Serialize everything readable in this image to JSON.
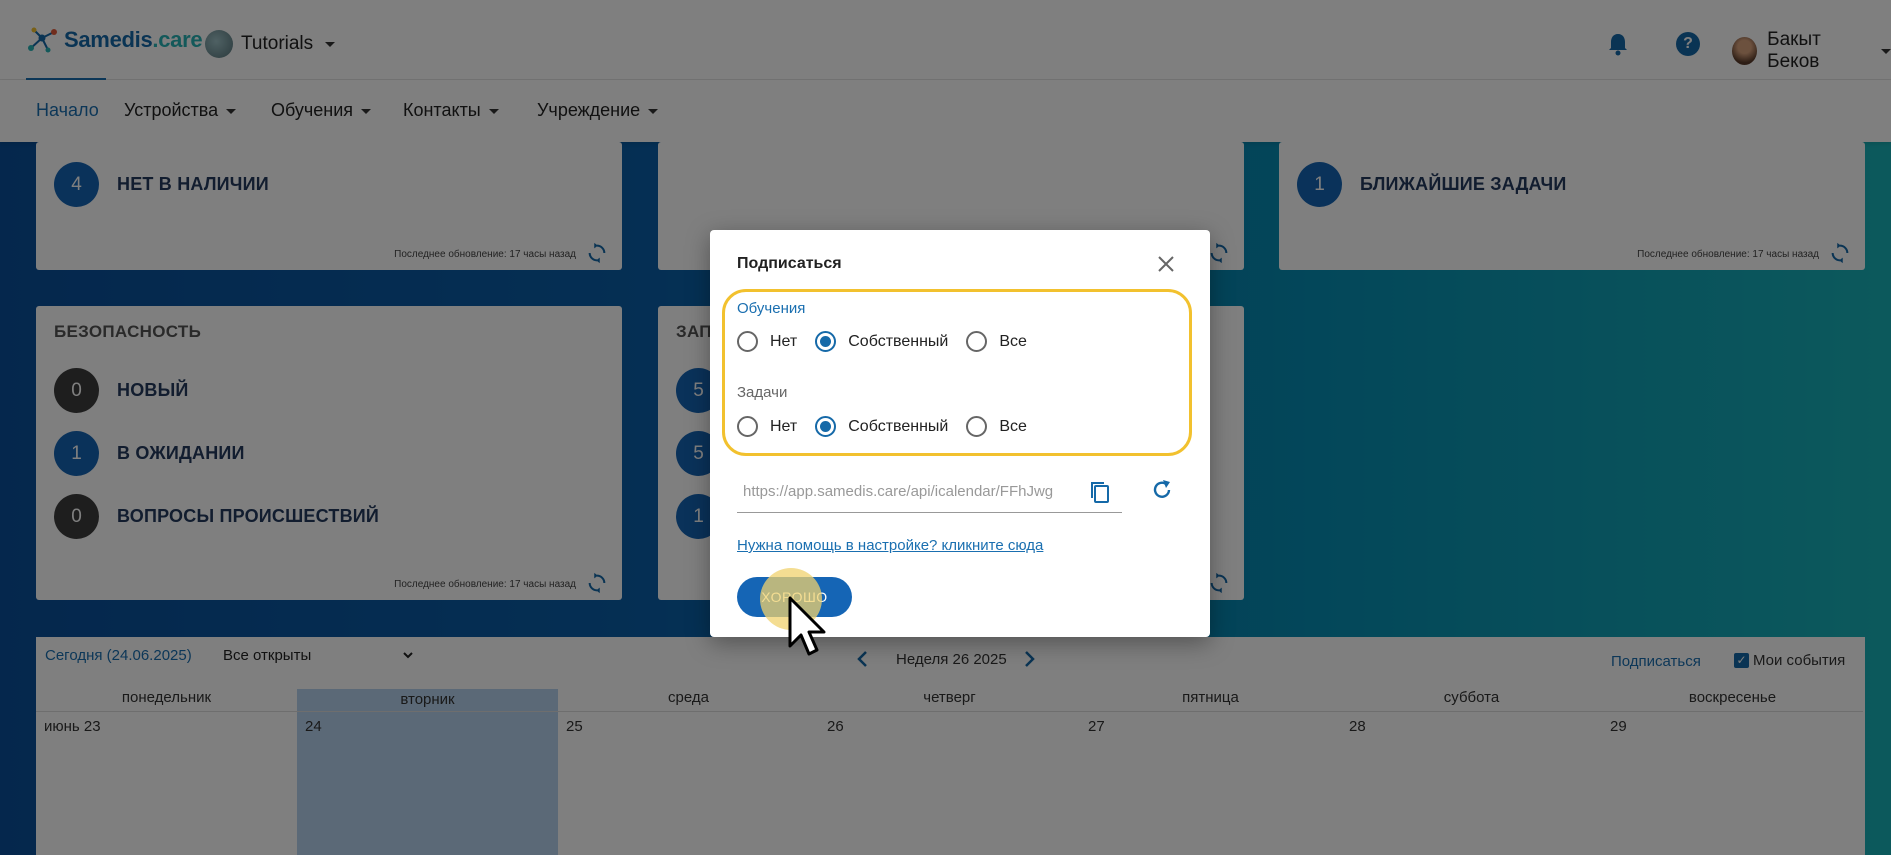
{
  "header": {
    "brand": "Samedis",
    "brand_suffix": ".care",
    "tenant": "Tutorials",
    "user_name": "Бакыт Беков"
  },
  "nav": {
    "items": [
      "Начало",
      "Устройства",
      "Обучения",
      "Контакты",
      "Учреждение"
    ]
  },
  "cards": {
    "devices": {
      "count": "4",
      "label": "НЕТ В НАЛИЧИИ",
      "updated": "Последнее обновление: 17 часы назад"
    },
    "tasks": {
      "count": "1",
      "label": "БЛИЖАЙШИЕ ЗАДАЧИ",
      "updated": "Последнее обновление: 17 часы назад"
    },
    "security": {
      "title": "БЕЗОПАСНОСТЬ",
      "rows": [
        {
          "count": "0",
          "label": "НОВЫЙ"
        },
        {
          "count": "1",
          "label": "В ОЖИДАНИИ"
        },
        {
          "count": "0",
          "label": "ВОПРОСЫ ПРОИСШЕСТВИЙ"
        }
      ],
      "updated": "Последнее обновление: 17 часы назад"
    },
    "requests": {
      "title_partial": "ЗАП",
      "counts": [
        "5",
        "5",
        "1"
      ]
    }
  },
  "calendar": {
    "today": "Сегодня (24.06.2025)",
    "filter": "Все открыты",
    "week": "Неделя 26 2025",
    "subscribe": "Подписаться",
    "my_events": "Мои события",
    "days": [
      "понедельник",
      "вторник",
      "среда",
      "четверг",
      "пятница",
      "суббота",
      "воскресенье"
    ],
    "dates": [
      "июнь 23",
      "24",
      "25",
      "26",
      "27",
      "28",
      "29"
    ]
  },
  "dialog": {
    "title": "Подписаться",
    "group1": {
      "label": "Обучения",
      "options": [
        "Нет",
        "Собственный",
        "Все"
      ],
      "selected": "Собственный"
    },
    "group2": {
      "label": "Задачи",
      "options": [
        "Нет",
        "Собственный",
        "Все"
      ],
      "selected": "Собственный"
    },
    "url": "https://app.samedis.care/api/icalendar/FFhJwg",
    "help_link": "Нужна помощь в настройке? кликните сюда",
    "ok": "ХОРОШО"
  },
  "colors": {
    "primary": "#1565b5",
    "highlight": "#f2c12e",
    "overlay": "rgba(0,0,0,0.5)"
  }
}
